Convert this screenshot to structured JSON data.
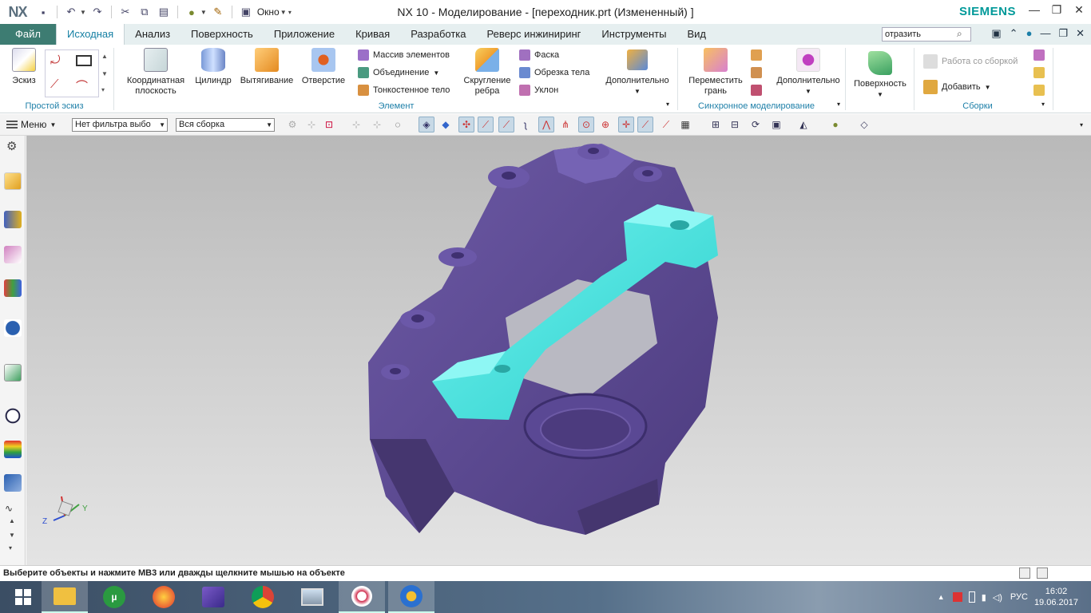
{
  "app": {
    "logo": "NX",
    "title": "NX 10 - Моделирование - [переходник.prt (Измененный) ]",
    "brand": "SIEMENS",
    "window_menu": "Окно"
  },
  "tabs": [
    "Файл",
    "Исходная",
    "Анализ",
    "Поверхность",
    "Приложение",
    "Кривая",
    "Разработка",
    "Реверс инжиниринг",
    "Инструменты",
    "Вид"
  ],
  "command_search": {
    "value": "отразить"
  },
  "ribbon": {
    "sketch": {
      "label": "Эскиз",
      "group": "Простой эскиз"
    },
    "feature": {
      "group": "Элемент",
      "datum_plane": [
        "Координатная",
        "плоскость"
      ],
      "cylinder": "Цилиндр",
      "extrude": "Вытягивание",
      "hole": "Отверстие",
      "pattern": "Массив элементов",
      "unite": "Объединение",
      "shell": "Тонкостенное тело",
      "blend": [
        "Скругление",
        "ребра"
      ],
      "chamfer": "Фаска",
      "trim_body": "Обрезка тела",
      "draft": "Уклон",
      "more": "Дополнительно"
    },
    "sync": {
      "group": "Синхронное моделирование",
      "move_face": [
        "Переместить",
        "грань"
      ],
      "more": "Дополнительно"
    },
    "surface": {
      "label": "Поверхность"
    },
    "assembly": {
      "group": "Сборки",
      "work_with": "Работа со сборкой",
      "add": "Добавить"
    }
  },
  "selection_bar": {
    "menu": "Меню",
    "type_filter": "Нет фильтра выбо",
    "scope": "Вся сборка"
  },
  "triad": {
    "z": "Z",
    "y": "Y"
  },
  "status": "Выберите объекты и нажмите MB3 или дважды щелкните мышью на объекте",
  "taskbar": {
    "lang": "РУС",
    "time": "16:02",
    "date": "19.06.2017"
  },
  "colors": {
    "accent": "#3d7c72",
    "tab_active": "#147fa3",
    "part_body": "#5b4a8c",
    "part_rod": "#3fe0dc"
  }
}
